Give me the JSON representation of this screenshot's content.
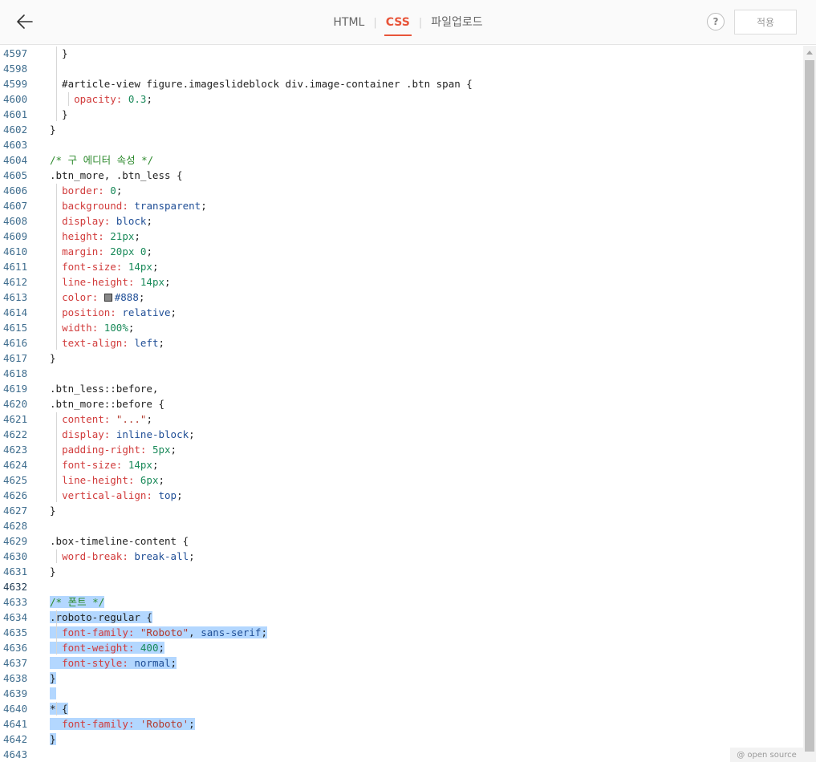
{
  "header": {
    "tabs": [
      {
        "label": "HTML",
        "active": false
      },
      {
        "label": "CSS",
        "active": true
      },
      {
        "label": "파일업로드",
        "active": false
      }
    ],
    "help_label": "?",
    "apply_label": "적용"
  },
  "footer": {
    "open_source_label": "@ open source"
  },
  "colors": {
    "accent": "#e8553a",
    "selection": "#b3d7ff",
    "line_number": "#3f6d8e"
  },
  "editor": {
    "current_line": "4632",
    "lines": [
      {
        "n": "4597",
        "tokens": [
          {
            "t": "  }",
            "c": ""
          }
        ]
      },
      {
        "n": "4598",
        "tokens": []
      },
      {
        "n": "4599",
        "tokens": [
          {
            "t": "  #article-view figure.imageslideblock div.image-container .btn span {",
            "c": ""
          }
        ]
      },
      {
        "n": "4600",
        "tokens": [
          {
            "t": "    ",
            "c": ""
          },
          {
            "t": "opacity:",
            "c": "t-prop"
          },
          {
            "t": " ",
            "c": ""
          },
          {
            "t": "0.3",
            "c": "t-num"
          },
          {
            "t": ";",
            "c": ""
          }
        ]
      },
      {
        "n": "4601",
        "tokens": [
          {
            "t": "  }",
            "c": ""
          }
        ]
      },
      {
        "n": "4602",
        "tokens": [
          {
            "t": "}",
            "c": ""
          }
        ]
      },
      {
        "n": "4603",
        "tokens": []
      },
      {
        "n": "4604",
        "tokens": [
          {
            "t": "/* 구 에디터 속성 */",
            "c": "t-comment"
          }
        ]
      },
      {
        "n": "4605",
        "tokens": [
          {
            "t": ".btn_more, .btn_less {",
            "c": ""
          }
        ]
      },
      {
        "n": "4606",
        "tokens": [
          {
            "t": "  ",
            "c": ""
          },
          {
            "t": "border:",
            "c": "t-prop"
          },
          {
            "t": " ",
            "c": ""
          },
          {
            "t": "0",
            "c": "t-num"
          },
          {
            "t": ";",
            "c": ""
          }
        ]
      },
      {
        "n": "4607",
        "tokens": [
          {
            "t": "  ",
            "c": ""
          },
          {
            "t": "background:",
            "c": "t-prop"
          },
          {
            "t": " ",
            "c": ""
          },
          {
            "t": "transparent",
            "c": "t-val"
          },
          {
            "t": ";",
            "c": ""
          }
        ]
      },
      {
        "n": "4608",
        "tokens": [
          {
            "t": "  ",
            "c": ""
          },
          {
            "t": "display:",
            "c": "t-prop"
          },
          {
            "t": " ",
            "c": ""
          },
          {
            "t": "block",
            "c": "t-val"
          },
          {
            "t": ";",
            "c": ""
          }
        ]
      },
      {
        "n": "4609",
        "tokens": [
          {
            "t": "  ",
            "c": ""
          },
          {
            "t": "height:",
            "c": "t-prop"
          },
          {
            "t": " ",
            "c": ""
          },
          {
            "t": "21px",
            "c": "t-num"
          },
          {
            "t": ";",
            "c": ""
          }
        ]
      },
      {
        "n": "4610",
        "tokens": [
          {
            "t": "  ",
            "c": ""
          },
          {
            "t": "margin:",
            "c": "t-prop"
          },
          {
            "t": " ",
            "c": ""
          },
          {
            "t": "20px 0",
            "c": "t-num"
          },
          {
            "t": ";",
            "c": ""
          }
        ]
      },
      {
        "n": "4611",
        "tokens": [
          {
            "t": "  ",
            "c": ""
          },
          {
            "t": "font-size:",
            "c": "t-prop"
          },
          {
            "t": " ",
            "c": ""
          },
          {
            "t": "14px",
            "c": "t-num"
          },
          {
            "t": ";",
            "c": ""
          }
        ]
      },
      {
        "n": "4612",
        "tokens": [
          {
            "t": "  ",
            "c": ""
          },
          {
            "t": "line-height:",
            "c": "t-prop"
          },
          {
            "t": " ",
            "c": ""
          },
          {
            "t": "14px",
            "c": "t-num"
          },
          {
            "t": ";",
            "c": ""
          }
        ]
      },
      {
        "n": "4613",
        "tokens": [
          {
            "t": "  ",
            "c": ""
          },
          {
            "t": "color:",
            "c": "t-prop"
          },
          {
            "t": " ",
            "c": ""
          },
          {
            "t": "",
            "c": "swatch"
          },
          {
            "t": "#888",
            "c": "t-val"
          },
          {
            "t": ";",
            "c": ""
          }
        ]
      },
      {
        "n": "4614",
        "tokens": [
          {
            "t": "  ",
            "c": ""
          },
          {
            "t": "position:",
            "c": "t-prop"
          },
          {
            "t": " ",
            "c": ""
          },
          {
            "t": "relative",
            "c": "t-val"
          },
          {
            "t": ";",
            "c": ""
          }
        ]
      },
      {
        "n": "4615",
        "tokens": [
          {
            "t": "  ",
            "c": ""
          },
          {
            "t": "width:",
            "c": "t-prop"
          },
          {
            "t": " ",
            "c": ""
          },
          {
            "t": "100%",
            "c": "t-num"
          },
          {
            "t": ";",
            "c": ""
          }
        ]
      },
      {
        "n": "4616",
        "tokens": [
          {
            "t": "  ",
            "c": ""
          },
          {
            "t": "text-align:",
            "c": "t-prop"
          },
          {
            "t": " ",
            "c": ""
          },
          {
            "t": "left",
            "c": "t-val"
          },
          {
            "t": ";",
            "c": ""
          }
        ]
      },
      {
        "n": "4617",
        "tokens": [
          {
            "t": "}",
            "c": ""
          }
        ]
      },
      {
        "n": "4618",
        "tokens": []
      },
      {
        "n": "4619",
        "tokens": [
          {
            "t": ".btn_less::before,",
            "c": ""
          }
        ]
      },
      {
        "n": "4620",
        "tokens": [
          {
            "t": ".btn_more::before {",
            "c": ""
          }
        ]
      },
      {
        "n": "4621",
        "tokens": [
          {
            "t": "  ",
            "c": ""
          },
          {
            "t": "content:",
            "c": "t-prop"
          },
          {
            "t": " ",
            "c": ""
          },
          {
            "t": "\"...\"",
            "c": "t-str"
          },
          {
            "t": ";",
            "c": ""
          }
        ]
      },
      {
        "n": "4622",
        "tokens": [
          {
            "t": "  ",
            "c": ""
          },
          {
            "t": "display:",
            "c": "t-prop"
          },
          {
            "t": " ",
            "c": ""
          },
          {
            "t": "inline-block",
            "c": "t-val"
          },
          {
            "t": ";",
            "c": ""
          }
        ]
      },
      {
        "n": "4623",
        "tokens": [
          {
            "t": "  ",
            "c": ""
          },
          {
            "t": "padding-right:",
            "c": "t-prop"
          },
          {
            "t": " ",
            "c": ""
          },
          {
            "t": "5px",
            "c": "t-num"
          },
          {
            "t": ";",
            "c": ""
          }
        ]
      },
      {
        "n": "4624",
        "tokens": [
          {
            "t": "  ",
            "c": ""
          },
          {
            "t": "font-size:",
            "c": "t-prop"
          },
          {
            "t": " ",
            "c": ""
          },
          {
            "t": "14px",
            "c": "t-num"
          },
          {
            "t": ";",
            "c": ""
          }
        ]
      },
      {
        "n": "4625",
        "tokens": [
          {
            "t": "  ",
            "c": ""
          },
          {
            "t": "line-height:",
            "c": "t-prop"
          },
          {
            "t": " ",
            "c": ""
          },
          {
            "t": "6px",
            "c": "t-num"
          },
          {
            "t": ";",
            "c": ""
          }
        ]
      },
      {
        "n": "4626",
        "tokens": [
          {
            "t": "  ",
            "c": ""
          },
          {
            "t": "vertical-align:",
            "c": "t-prop"
          },
          {
            "t": " ",
            "c": ""
          },
          {
            "t": "top",
            "c": "t-val"
          },
          {
            "t": ";",
            "c": ""
          }
        ]
      },
      {
        "n": "4627",
        "tokens": [
          {
            "t": "}",
            "c": ""
          }
        ]
      },
      {
        "n": "4628",
        "tokens": []
      },
      {
        "n": "4629",
        "tokens": [
          {
            "t": ".box-timeline-content {",
            "c": ""
          }
        ]
      },
      {
        "n": "4630",
        "tokens": [
          {
            "t": "  ",
            "c": ""
          },
          {
            "t": "word-break:",
            "c": "t-prop"
          },
          {
            "t": " ",
            "c": ""
          },
          {
            "t": "break-all",
            "c": "t-val"
          },
          {
            "t": ";",
            "c": ""
          }
        ]
      },
      {
        "n": "4631",
        "tokens": [
          {
            "t": "}",
            "c": ""
          }
        ]
      },
      {
        "n": "4632",
        "tokens": []
      },
      {
        "n": "4633",
        "sel": true,
        "tokens": [
          {
            "t": "/* 폰트 */",
            "c": "t-comment"
          }
        ]
      },
      {
        "n": "4634",
        "sel": true,
        "tokens": [
          {
            "t": ".roboto-regular {",
            "c": ""
          }
        ]
      },
      {
        "n": "4635",
        "sel": true,
        "tokens": [
          {
            "t": "  ",
            "c": ""
          },
          {
            "t": "font-family:",
            "c": "t-prop"
          },
          {
            "t": " ",
            "c": ""
          },
          {
            "t": "\"Roboto\"",
            "c": "t-str"
          },
          {
            "t": ", ",
            "c": ""
          },
          {
            "t": "sans-serif",
            "c": "t-val"
          },
          {
            "t": ";",
            "c": ""
          }
        ]
      },
      {
        "n": "4636",
        "sel": true,
        "tokens": [
          {
            "t": "  ",
            "c": ""
          },
          {
            "t": "font-weight:",
            "c": "t-prop"
          },
          {
            "t": " ",
            "c": ""
          },
          {
            "t": "400",
            "c": "t-num"
          },
          {
            "t": ";",
            "c": ""
          }
        ]
      },
      {
        "n": "4637",
        "sel": true,
        "tokens": [
          {
            "t": "  ",
            "c": ""
          },
          {
            "t": "font-style:",
            "c": "t-prop"
          },
          {
            "t": " ",
            "c": ""
          },
          {
            "t": "normal",
            "c": "t-val"
          },
          {
            "t": ";",
            "c": ""
          }
        ]
      },
      {
        "n": "4638",
        "sel": true,
        "tokens": [
          {
            "t": "}",
            "c": ""
          }
        ]
      },
      {
        "n": "4639",
        "sel": true,
        "tokens": [
          {
            "t": "",
            "c": ""
          }
        ]
      },
      {
        "n": "4640",
        "sel": true,
        "tokens": [
          {
            "t": "* {",
            "c": ""
          }
        ]
      },
      {
        "n": "4641",
        "sel": true,
        "tokens": [
          {
            "t": "  ",
            "c": ""
          },
          {
            "t": "font-family:",
            "c": "t-prop"
          },
          {
            "t": " ",
            "c": ""
          },
          {
            "t": "'Roboto'",
            "c": "t-str"
          },
          {
            "t": ";",
            "c": ""
          }
        ]
      },
      {
        "n": "4642",
        "sel": true,
        "tokens": [
          {
            "t": "}",
            "c": ""
          }
        ]
      },
      {
        "n": "4643",
        "tokens": []
      }
    ]
  }
}
